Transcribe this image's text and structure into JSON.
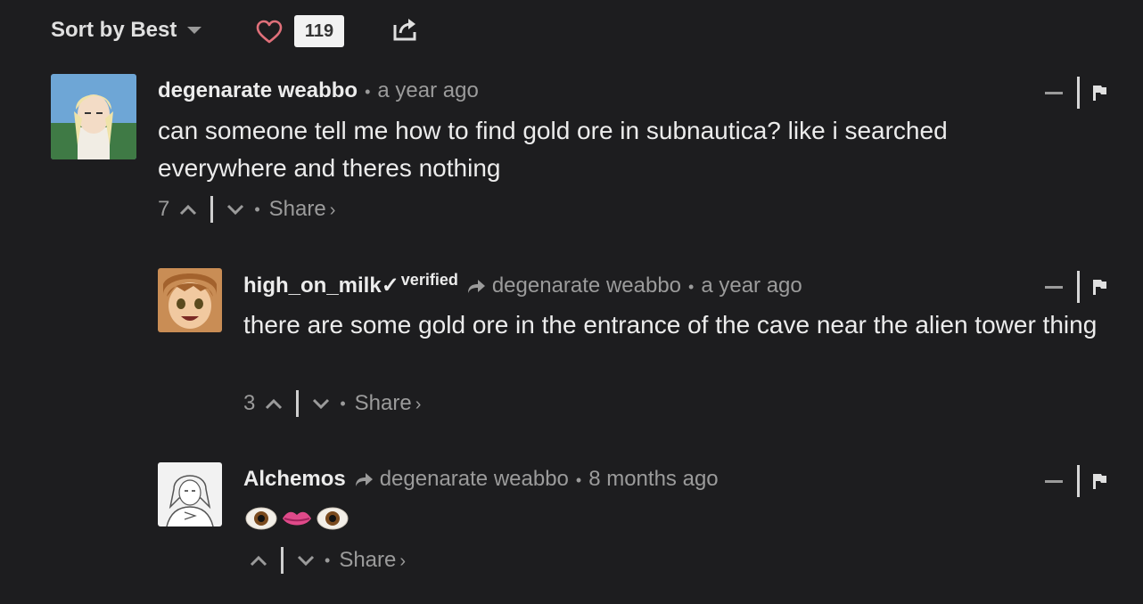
{
  "toolbar": {
    "sort_label": "Sort by Best",
    "like_count": "119"
  },
  "comments": [
    {
      "author": "degenarate weabbo",
      "time": "a year ago",
      "text": "can someone tell me how to find gold ore in subnautica? like i searched everywhere and theres nothing",
      "votes": "7",
      "share_label": "Share"
    },
    {
      "author": "high_on_milk✓",
      "verified_label": "verified",
      "reply_to": "degenarate weabbo",
      "time": "a year ago",
      "text": "there are some gold ore in the entrance of the cave near the alien tower thing",
      "votes": "3",
      "share_label": "Share"
    },
    {
      "author": "Alchemos",
      "reply_to": "degenarate weabbo",
      "time": "8 months ago",
      "text": "👁️👄👁️",
      "votes": "",
      "share_label": "Share"
    }
  ],
  "icons": {
    "heart": "heart-icon",
    "share": "share-icon",
    "upvote": "chevron-up-icon",
    "downvote": "chevron-down-icon",
    "collapse": "minus-icon",
    "flag": "flag-icon",
    "reply": "reply-arrow-icon"
  },
  "colors": {
    "background": "#1d1d1f",
    "heart": "#e0707a",
    "badge_bg": "#f2f2f2"
  }
}
